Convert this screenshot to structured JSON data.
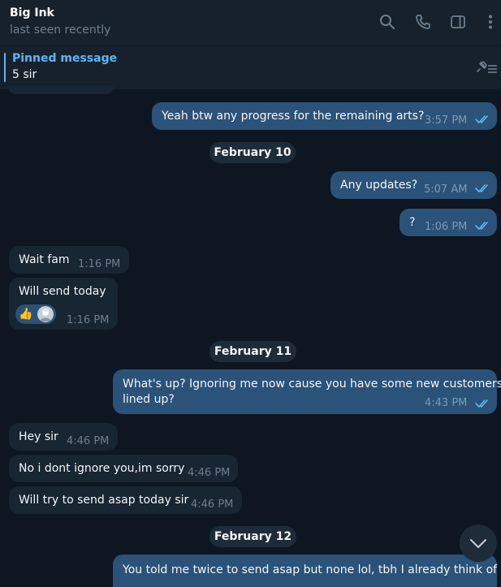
{
  "header": {
    "title": "Big Ink",
    "status": "last seen recently",
    "icons": [
      "search-icon",
      "phone-icon",
      "sidebar-toggle-icon",
      "more-vertical-icon"
    ]
  },
  "pinned": {
    "label": "Pinned message",
    "text": "5 sir",
    "icon": "unpin-list-icon"
  },
  "colors": {
    "background": "#0e1621",
    "header": "#17212b",
    "outgoing_bubble": "#2b5278",
    "incoming_bubble": "#182533",
    "accent": "#5eb5f7"
  },
  "messages": [
    {
      "direction": "out",
      "text": "Yeah btw any progress for the remaining arts?",
      "time": "3:57 PM",
      "read": true
    },
    {
      "type": "date",
      "text": "February 10"
    },
    {
      "direction": "out",
      "text": "Any updates?",
      "time": "5:07 AM",
      "read": true
    },
    {
      "direction": "out",
      "text": "?",
      "time": "1:06 PM",
      "read": true
    },
    {
      "direction": "in",
      "text": "Wait fam",
      "time": "1:16 PM"
    },
    {
      "direction": "in",
      "text": "Will send today",
      "time": "1:16 PM",
      "reaction": "thumbs-up-icon"
    },
    {
      "type": "date",
      "text": "February 11"
    },
    {
      "direction": "out",
      "text_line1": "What's up? Ignoring me now cause you have some new customers",
      "text_line2": "lined up?",
      "time": "4:43 PM",
      "read": true
    },
    {
      "direction": "in",
      "text": "Hey sir",
      "time": "4:46 PM"
    },
    {
      "direction": "in",
      "text": "No i dont ignore you,im sorry",
      "time": "4:46 PM"
    },
    {
      "direction": "in",
      "text": "Will try to send asap today sir",
      "time": "4:46 PM"
    },
    {
      "type": "date",
      "text": "February 12"
    },
    {
      "direction": "out",
      "text": "You told me twice to send asap but none lol, tbh I already think of",
      "partial": true
    }
  ],
  "scroll_button": {
    "icon": "chevron-down-icon"
  }
}
